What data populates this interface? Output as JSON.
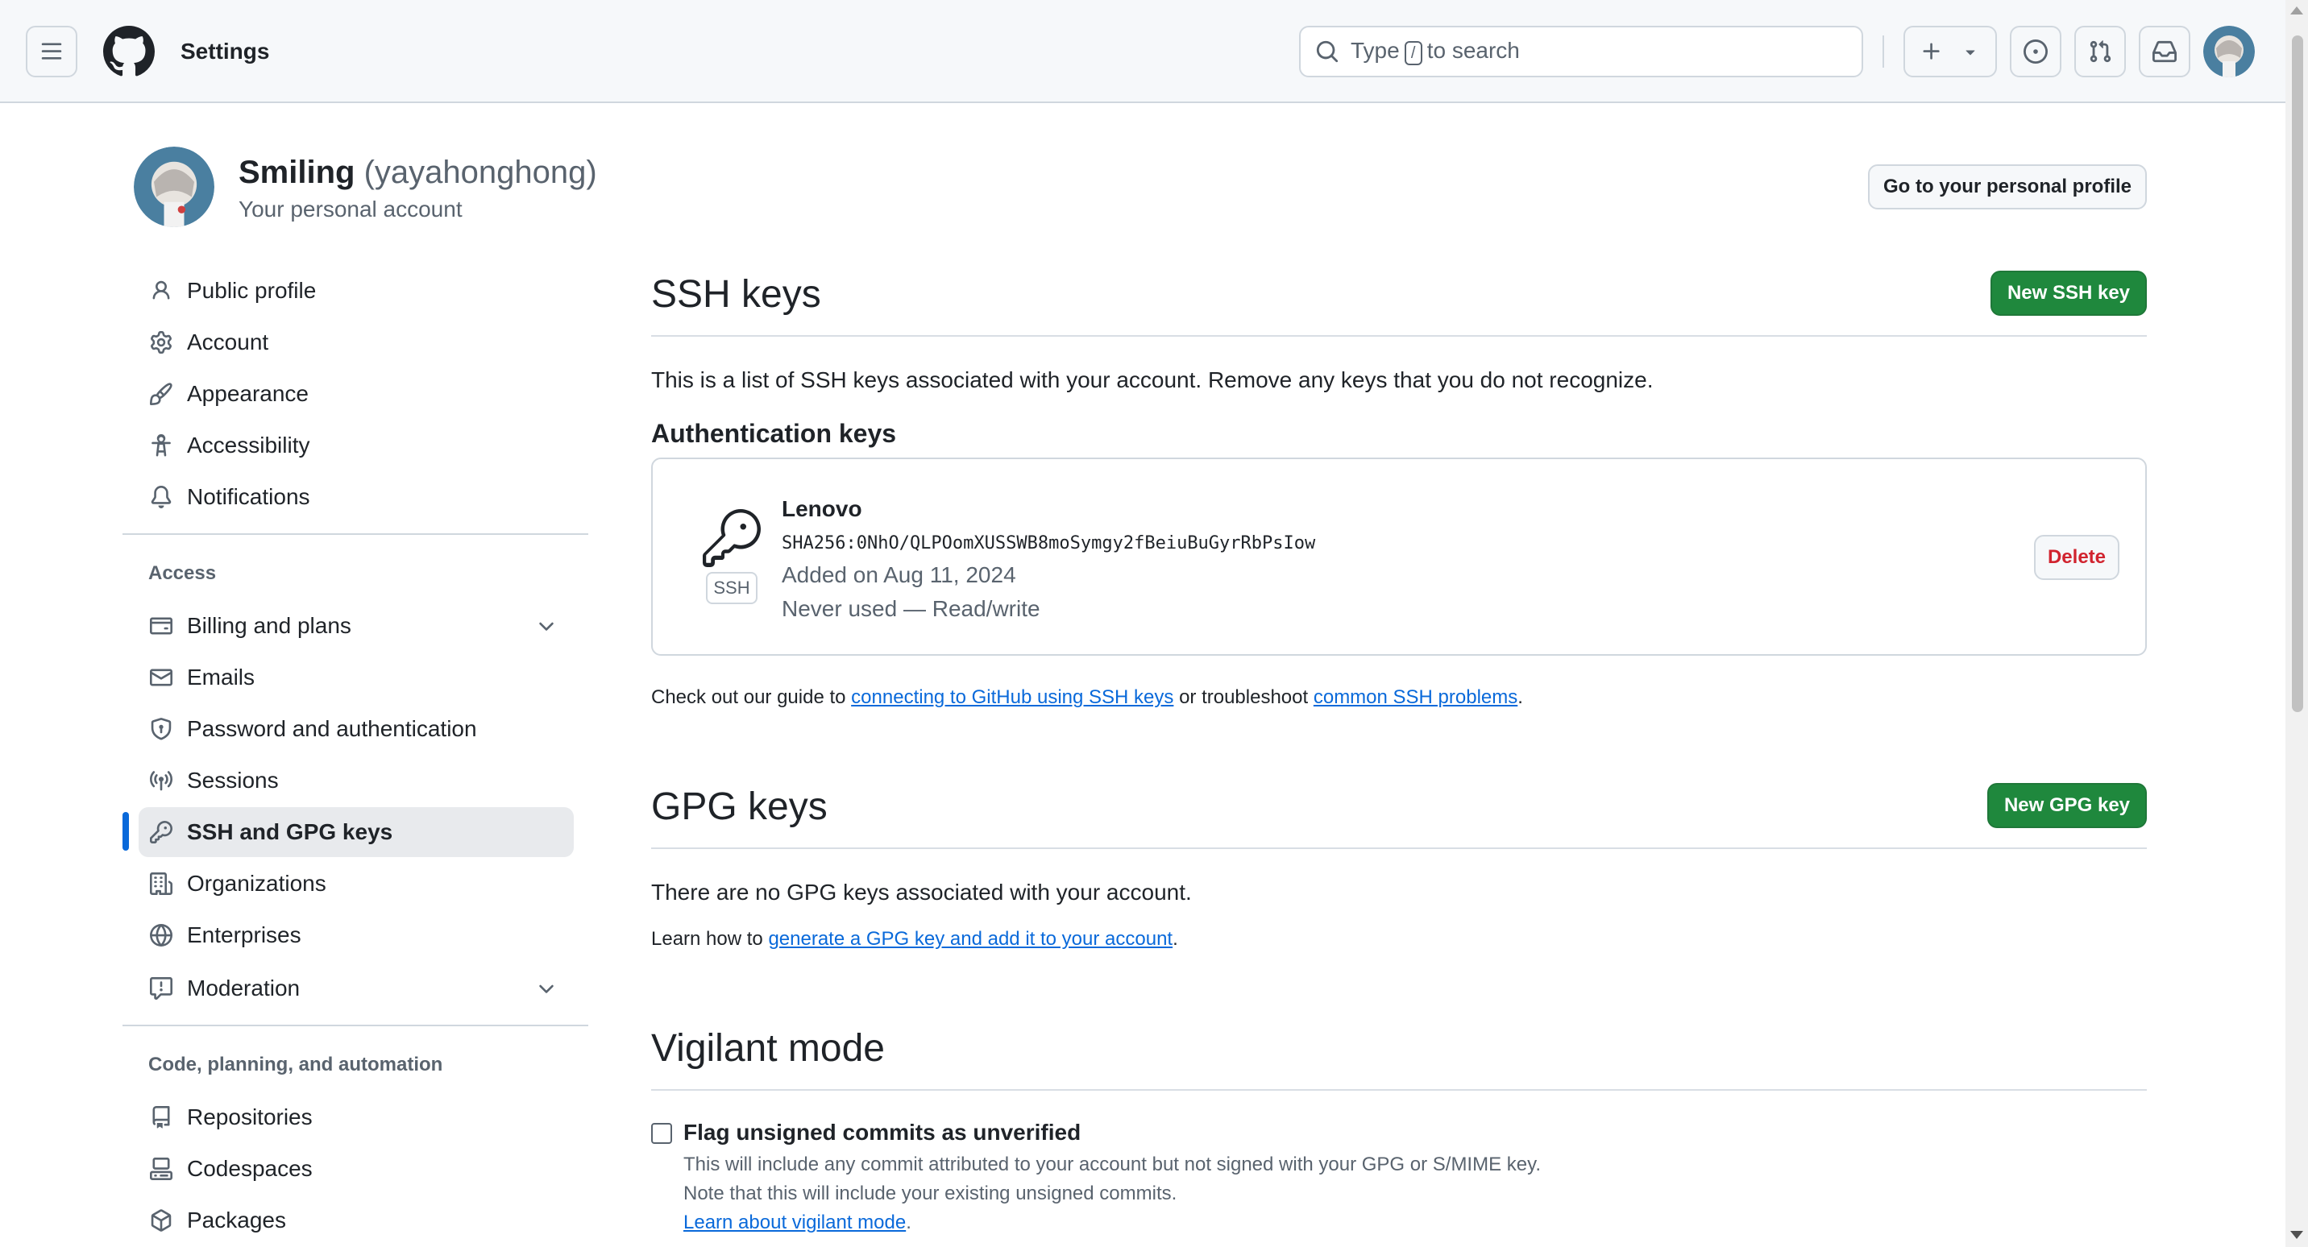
{
  "header": {
    "title": "Settings",
    "search": {
      "prefix": "Type",
      "key": "/",
      "suffix": "to search"
    }
  },
  "profile": {
    "name": "Smiling",
    "handle": "(yayahonghong)",
    "subtitle": "Your personal account",
    "profile_button": "Go to your personal profile"
  },
  "sidebar": {
    "items": [
      {
        "label": "Public profile",
        "icon": "person-icon"
      },
      {
        "label": "Account",
        "icon": "gear-icon"
      },
      {
        "label": "Appearance",
        "icon": "paintbrush-icon"
      },
      {
        "label": "Accessibility",
        "icon": "accessibility-icon"
      },
      {
        "label": "Notifications",
        "icon": "bell-icon"
      }
    ],
    "access_heading": "Access",
    "access_items": [
      {
        "label": "Billing and plans",
        "icon": "credit-card-icon"
      },
      {
        "label": "Emails",
        "icon": "mail-icon"
      },
      {
        "label": "Password and authentication",
        "icon": "shield-lock-icon"
      },
      {
        "label": "Sessions",
        "icon": "broadcast-icon"
      },
      {
        "label": "SSH and GPG keys",
        "icon": "key-icon"
      },
      {
        "label": "Organizations",
        "icon": "organization-icon"
      },
      {
        "label": "Enterprises",
        "icon": "globe-icon"
      },
      {
        "label": "Moderation",
        "icon": "report-icon"
      }
    ],
    "code_heading": "Code, planning, and automation",
    "code_items": [
      {
        "label": "Repositories",
        "icon": "repo-icon"
      },
      {
        "label": "Codespaces",
        "icon": "codespaces-icon"
      },
      {
        "label": "Packages",
        "icon": "package-icon"
      }
    ]
  },
  "ssh": {
    "title": "SSH keys",
    "new_button": "New SSH key",
    "description": "This is a list of SSH keys associated with your account. Remove any keys that you do not recognize.",
    "auth_heading": "Authentication keys",
    "key": {
      "badge": "SSH",
      "name": "Lenovo",
      "fingerprint": "SHA256:0NhO/QLPOomXUSSWB8moSymgy2fBeiuBuGyrRbPsIow",
      "added": "Added on Aug 11, 2024",
      "usage": "Never used — Read/write",
      "delete": "Delete"
    },
    "guide_prefix": "Check out our guide to",
    "guide_link": "connecting to GitHub using SSH keys",
    "guide_middle": "or troubleshoot",
    "guide_link2": "common SSH problems",
    "guide_suffix": "."
  },
  "gpg": {
    "title": "GPG keys",
    "new_button": "New GPG key",
    "description": "There are no GPG keys associated with your account.",
    "learn_prefix": "Learn how to",
    "learn_link": "generate a GPG key and add it to your account",
    "learn_suffix": "."
  },
  "vigilant": {
    "title": "Vigilant mode",
    "checkbox_label": "Flag unsigned commits as unverified",
    "note1": "This will include any commit attributed to your account but not signed with your GPG or S/MIME key.",
    "note2": "Note that this will include your existing unsigned commits.",
    "learn_link": "Learn about vigilant mode",
    "learn_suffix": "."
  },
  "colors": {
    "primary_green": "#1f883d",
    "link_blue": "#0969da",
    "danger_red": "#d1242f",
    "active_indicator": "#0969da"
  }
}
